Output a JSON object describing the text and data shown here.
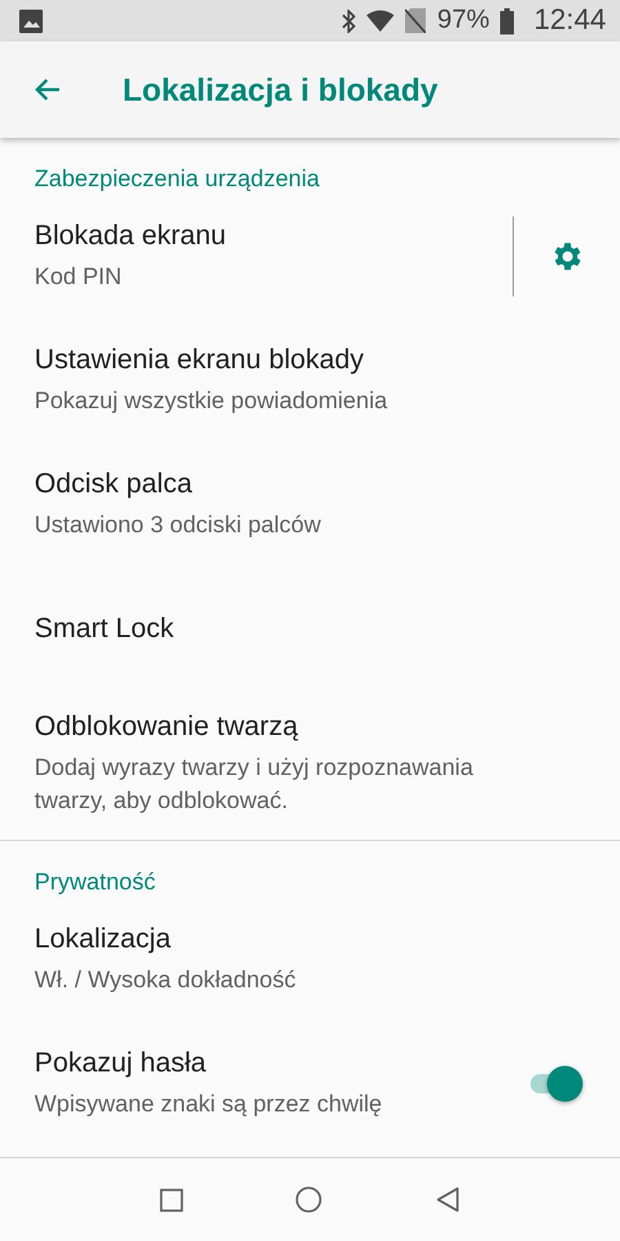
{
  "status_bar": {
    "battery": "97%",
    "time": "12:44"
  },
  "app_bar": {
    "title": "Lokalizacja i blokady"
  },
  "sections": [
    {
      "header": "Zabezpieczenia urządzenia",
      "items": [
        {
          "kind": "gear",
          "title": "Blokada ekranu",
          "summary": "Kod PIN"
        },
        {
          "kind": "plain",
          "title": "Ustawienia ekranu blokady",
          "summary": "Pokazuj wszystkie powiadomienia"
        },
        {
          "kind": "plain",
          "title": "Odcisk palca",
          "summary": "Ustawiono 3 odciski palców"
        },
        {
          "kind": "plain",
          "title": "Smart Lock"
        },
        {
          "kind": "plain",
          "title": "Odblokowanie twarzą",
          "summary": "Dodaj wyrazy twarzy i użyj rozpoznawania twarzy, aby odblokować."
        }
      ]
    },
    {
      "header": "Prywatność",
      "items": [
        {
          "kind": "plain",
          "title": "Lokalizacja",
          "summary": "Wł. / Wysoka dokładność"
        },
        {
          "kind": "switch",
          "title": "Pokazuj hasła",
          "summary": "Wpisywane znaki są przez chwilę",
          "on": true
        }
      ]
    }
  ]
}
